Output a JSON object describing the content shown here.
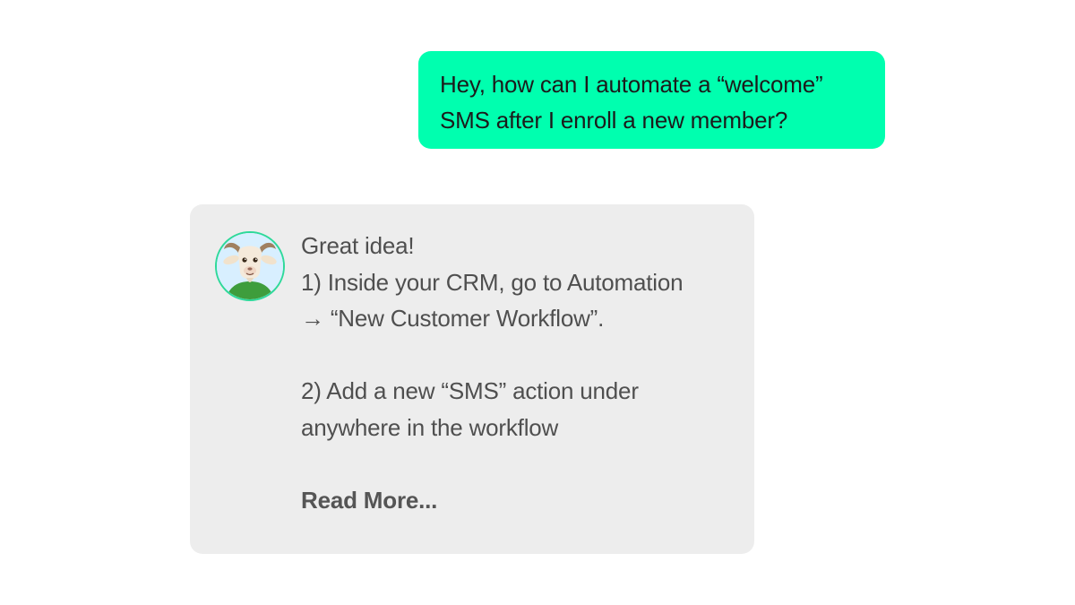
{
  "user_message": {
    "lines": [
      "Hey, how can I automate a “welcome”",
      "SMS after I enroll a new member?"
    ],
    "bubble_color": "#00ffaf"
  },
  "assistant_message": {
    "avatar": "goat-mascot-avatar",
    "greeting": "Great idea!",
    "step1_lines": [
      "1) Inside your CRM, go to Automation",
      "→ “New Customer Workflow”."
    ],
    "step2_lines": [
      "2) Add a new “SMS” action under",
      "anywhere in the workflow"
    ],
    "read_more": "Read More...",
    "bubble_color": "#ededed",
    "avatar_ring_color": "#2ed99a"
  }
}
